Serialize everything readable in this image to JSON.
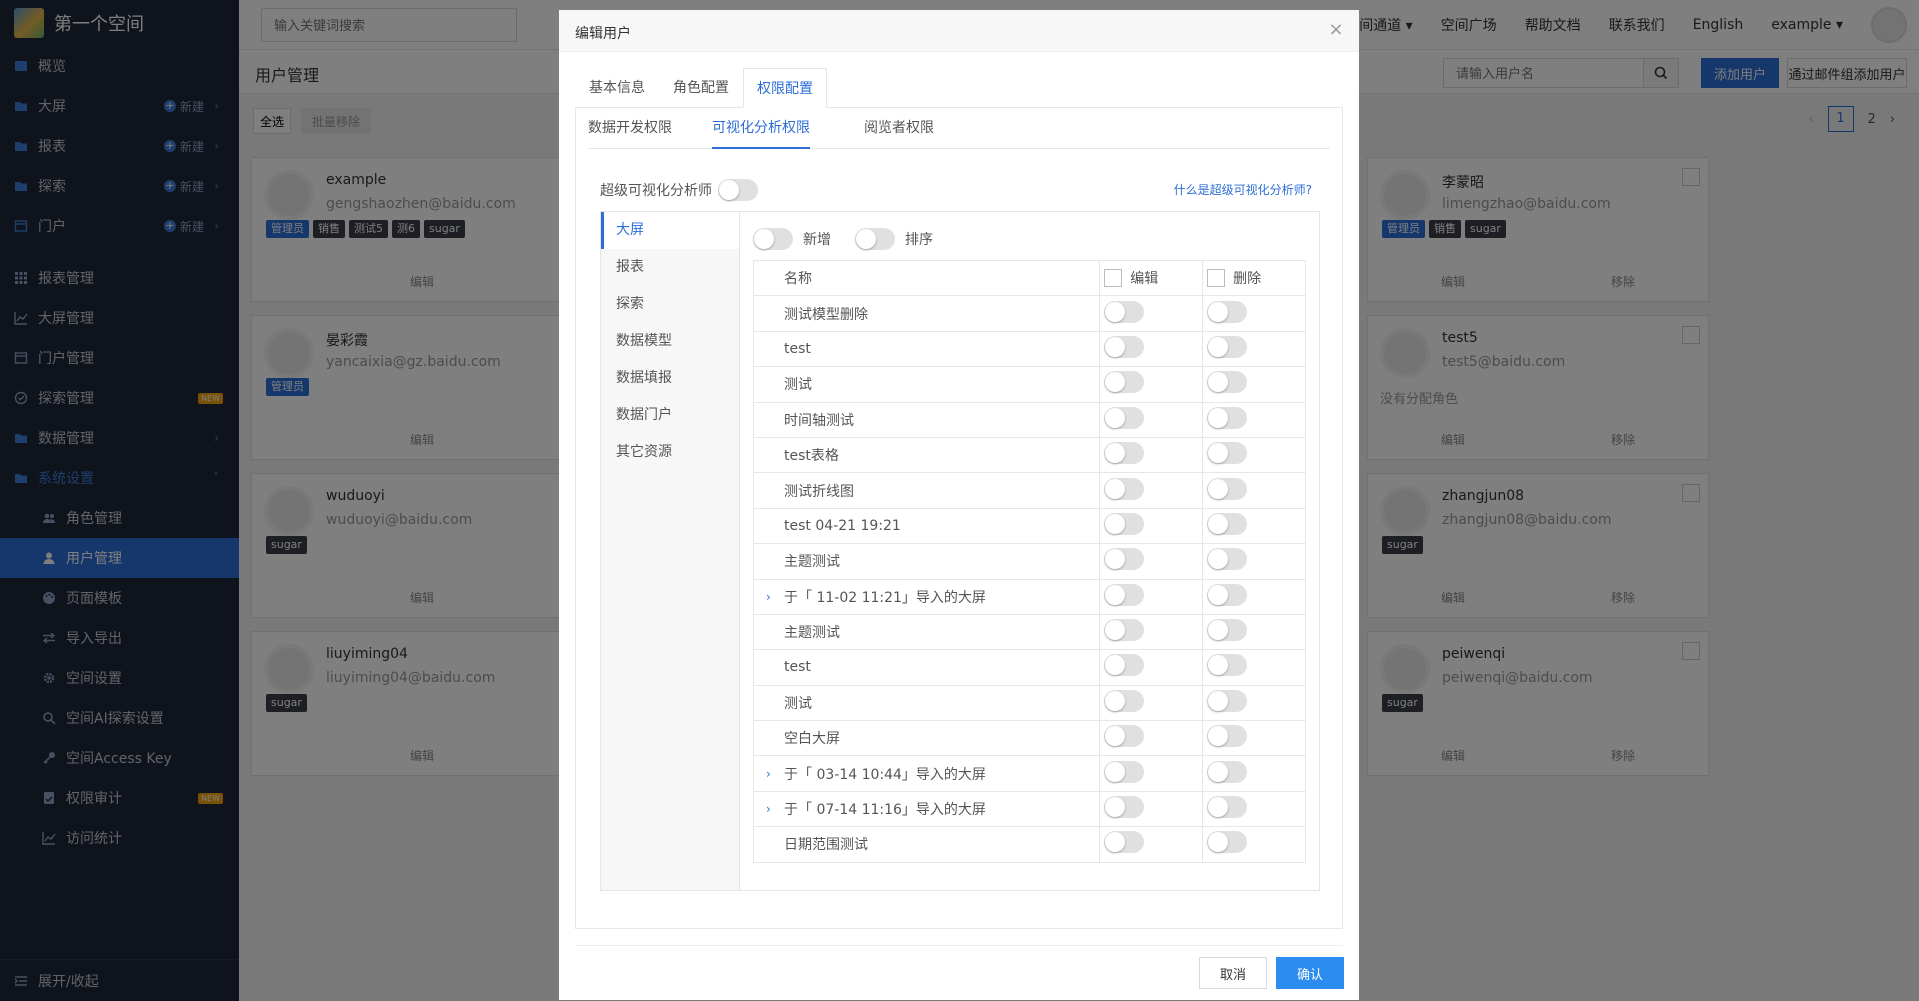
{
  "sidebar": {
    "title": "第一个空间",
    "items": [
      {
        "label": "概览",
        "icon": "dashboard-icon"
      },
      {
        "label": "大屏",
        "icon": "folder-icon",
        "new": "新建"
      },
      {
        "label": "报表",
        "icon": "folder-icon",
        "new": "新建"
      },
      {
        "label": "探索",
        "icon": "folder-icon",
        "new": "新建"
      },
      {
        "label": "门户",
        "icon": "window-icon",
        "new": "新建"
      }
    ],
    "manage": [
      {
        "label": "报表管理",
        "icon": "grid-icon"
      },
      {
        "label": "大屏管理",
        "icon": "chart-icon"
      },
      {
        "label": "门户管理",
        "icon": "window-icon"
      },
      {
        "label": "探索管理",
        "icon": "compass-icon",
        "badge": "NEW"
      },
      {
        "label": "数据管理",
        "icon": "folder-icon"
      },
      {
        "label": "系统设置",
        "icon": "folder-icon"
      }
    ],
    "sub": [
      {
        "label": "角色管理",
        "icon": "users-icon"
      },
      {
        "label": "用户管理",
        "icon": "user-icon"
      },
      {
        "label": "页面模板",
        "icon": "palette-icon"
      },
      {
        "label": "导入导出",
        "icon": "swap-icon"
      },
      {
        "label": "空间设置",
        "icon": "gear-icon"
      },
      {
        "label": "空间AI探索设置",
        "icon": "search-icon"
      },
      {
        "label": "空间Access Key",
        "icon": "key-icon"
      },
      {
        "label": "权限审计",
        "icon": "audit-icon",
        "badge": "NEW"
      },
      {
        "label": "访问统计",
        "icon": "chart-icon"
      }
    ],
    "footer": "展开/收起"
  },
  "topbar": {
    "search_placeholder": "输入关键词搜索",
    "nav": [
      "空间通道",
      "空间广场",
      "帮助文档",
      "联系我们",
      "English",
      "example"
    ]
  },
  "main": {
    "title": "用户管理",
    "search_placeholder": "请输入用户名",
    "add_user": "添加用户",
    "add_by_mail": "通过邮件组添加用户",
    "select_all": "全选",
    "bulk_remove": "批量移除",
    "pages": [
      "1",
      "2"
    ]
  },
  "cards": [
    {
      "name": "example",
      "mail": "gengshaozhen@baidu.com",
      "tags": [
        {
          "t": "管理员",
          "blue": true
        },
        {
          "t": "销售"
        },
        {
          "t": "测试5"
        },
        {
          "t": "测6"
        },
        {
          "t": "sugar"
        }
      ],
      "edit": "编辑",
      "remove": ""
    },
    {
      "name": "晏彩霞",
      "mail": "yancaixia@gz.baidu.com",
      "tags": [
        {
          "t": "管理员",
          "blue": true
        }
      ],
      "edit": "编辑",
      "remove": ""
    },
    {
      "name": "wuduoyi",
      "mail": "wuduoyi@baidu.com",
      "tags": [
        {
          "t": "sugar"
        }
      ],
      "edit": "编辑",
      "remove": ""
    },
    {
      "name": "liuyiming04",
      "mail": "liuyiming04@baidu.com",
      "tags": [
        {
          "t": "sugar"
        }
      ],
      "edit": "编辑",
      "remove": ""
    },
    {
      "name": "李蒙昭",
      "mail": "limengzhao@baidu.com",
      "tags": [
        {
          "t": "管理员",
          "blue": true
        },
        {
          "t": "销售"
        },
        {
          "t": "sugar"
        }
      ],
      "edit": "编辑",
      "remove": "移除"
    },
    {
      "name": "test5",
      "mail": "test5@baidu.com",
      "tags": [],
      "norole": "没有分配角色",
      "edit": "编辑",
      "remove": "移除"
    },
    {
      "name": "zhangjun08",
      "mail": "zhangjun08@baidu.com",
      "tags": [
        {
          "t": "sugar"
        }
      ],
      "edit": "编辑",
      "remove": "移除"
    },
    {
      "name": "peiwenqi",
      "mail": "peiwenqi@baidu.com",
      "tags": [
        {
          "t": "sugar"
        }
      ],
      "edit": "编辑",
      "remove": "移除"
    }
  ],
  "modal": {
    "title": "编辑用户",
    "tabs": [
      "基本信息",
      "角色配置",
      "权限配置"
    ],
    "subtabs": [
      "数据开发权限",
      "可视化分析权限",
      "阅览者权限"
    ],
    "super_label": "超级可视化分析师",
    "super_link": "什么是超级可视化分析师?",
    "side": [
      "大屏",
      "报表",
      "探索",
      "数据模型",
      "数据填报",
      "数据门户",
      "其它资源"
    ],
    "controls": {
      "add": "新增",
      "sort": "排序"
    },
    "table": {
      "headers": {
        "name": "名称",
        "edit": "编辑",
        "delete": "删除"
      },
      "rows": [
        {
          "name": "测试模型删除",
          "expand": false
        },
        {
          "name": "test",
          "expand": false
        },
        {
          "name": "测试",
          "expand": false
        },
        {
          "name": "时间轴测试",
          "expand": false
        },
        {
          "name": "test表格",
          "expand": false
        },
        {
          "name": "测试折线图",
          "expand": false
        },
        {
          "name": "test 04-21 19:21",
          "expand": false
        },
        {
          "name": "主题测试",
          "expand": false
        },
        {
          "name": "于「 11-02 11:21」导入的大屏",
          "expand": true
        },
        {
          "name": "主题测试",
          "expand": false
        },
        {
          "name": "test",
          "expand": false
        },
        {
          "name": "测试",
          "expand": false
        },
        {
          "name": "空白大屏",
          "expand": false
        },
        {
          "name": "于「 03-14 10:44」导入的大屏",
          "expand": true
        },
        {
          "name": "于「 07-14 11:16」导入的大屏",
          "expand": true
        },
        {
          "name": "日期范围测试",
          "expand": false
        }
      ]
    },
    "cancel": "取消",
    "confirm": "确认"
  },
  "colors": {
    "accent": "#2d6ed6",
    "sidebar": "#1f2736"
  }
}
